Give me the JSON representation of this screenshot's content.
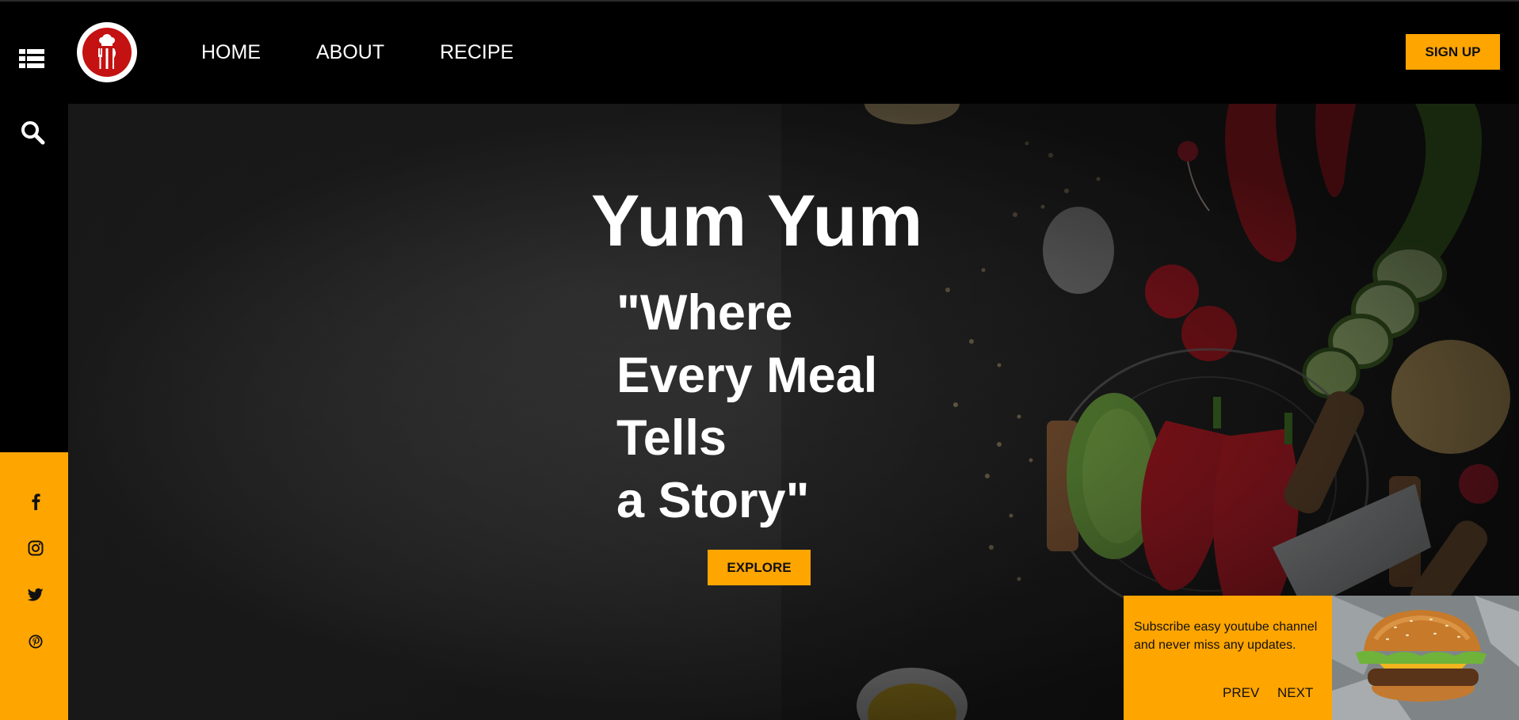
{
  "header": {
    "nav": [
      {
        "label": "HOME"
      },
      {
        "label": "ABOUT"
      },
      {
        "label": "RECIPE"
      }
    ],
    "signup_label": "SIGN UP",
    "icons": {
      "menu": "list-icon",
      "logo": "chef-utensils-logo"
    }
  },
  "sidebar": {
    "icons": [
      "search-icon"
    ],
    "social": [
      "facebook-icon",
      "instagram-icon",
      "twitter-icon",
      "pinterest-icon"
    ]
  },
  "hero": {
    "title": "Yum Yum",
    "quote_lines": [
      "\"Where",
      "Every Meal",
      "Tells",
      "a Story\""
    ],
    "explore_label": "EXPLORE"
  },
  "promo": {
    "text": "Subscribe easy youtube channel and never miss any updates.",
    "prev_label": "PREV",
    "next_label": "NEXT"
  },
  "colors": {
    "accent": "#ffa500",
    "background": "#000000",
    "logo_red": "#c41111"
  }
}
